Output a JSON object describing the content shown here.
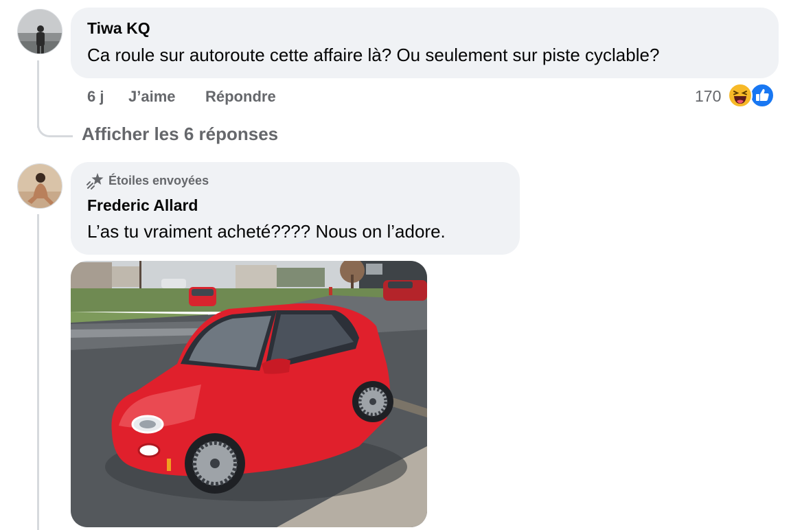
{
  "comment1": {
    "author": "Tiwa KQ",
    "text": "Ca roule sur autoroute cette affaire là? Ou seulement sur piste cyclable?",
    "time": "6 j",
    "like_label": "J’aime",
    "reply_label": "Répondre",
    "reaction_count": "170",
    "reactions": [
      "laughing-emoji-icon",
      "like-thumb-icon"
    ],
    "view_replies_label": "Afficher les 6 réponses"
  },
  "comment2": {
    "badge": "Étoiles envoyées",
    "badge_icon": "stars-sent-icon",
    "author": "Frederic Allard",
    "text": "L’as tu vraiment acheté???? Nous on l’adore.",
    "attachment": "red-electric-car-photo"
  },
  "colors": {
    "bubble": "#f0f2f5",
    "meta_text": "#65676b",
    "like_blue": "#1877f2",
    "haha_yellow": "#f7b928",
    "car_red": "#e0202c"
  }
}
